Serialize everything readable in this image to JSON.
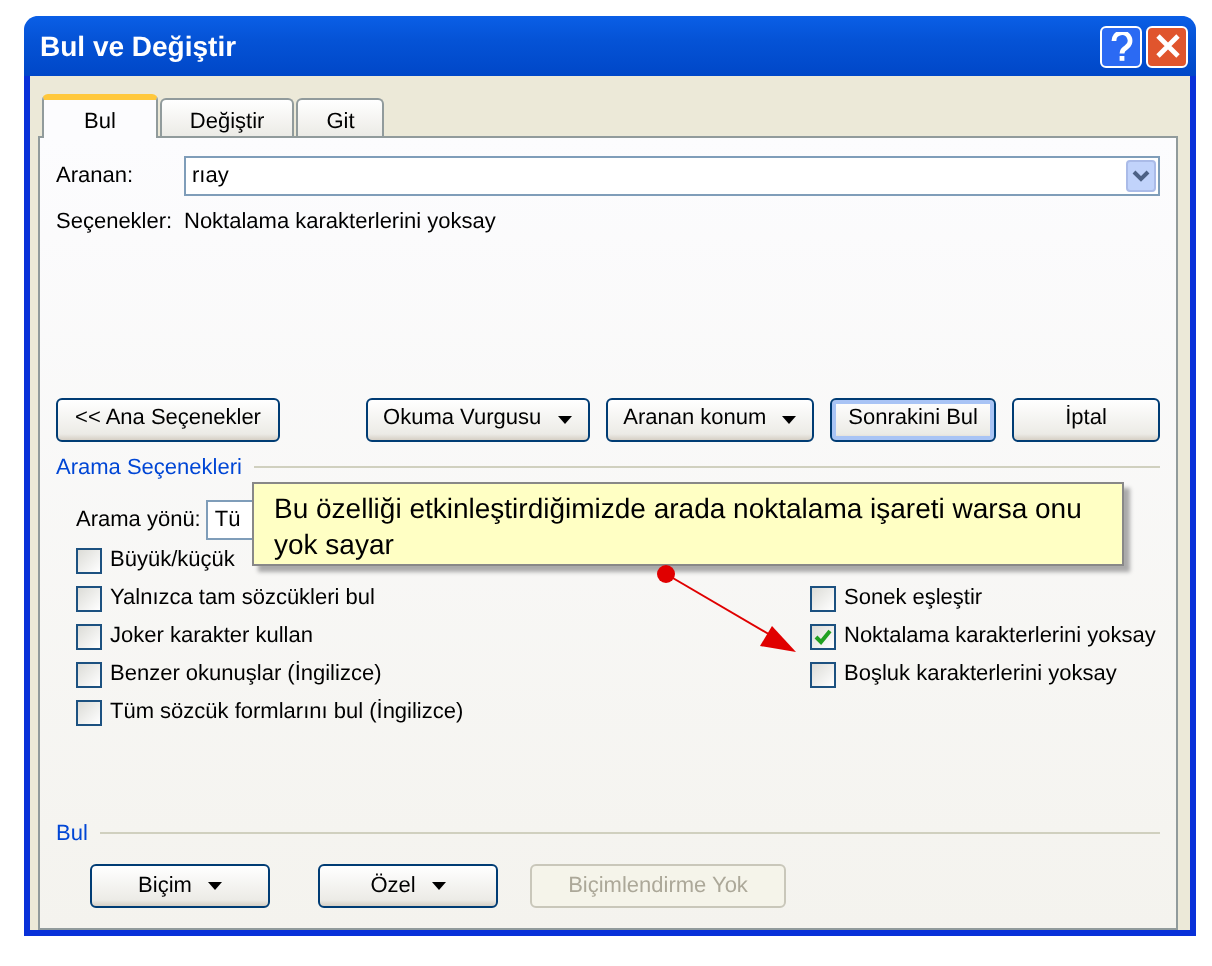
{
  "window": {
    "title": "Bul ve Değiştir"
  },
  "tabs": [
    {
      "label": "Bul",
      "selected": true
    },
    {
      "label": "Değiştir",
      "selected": false
    },
    {
      "label": "Git",
      "selected": false
    }
  ],
  "find": {
    "label": "Aranan:",
    "value": "rıay"
  },
  "options_line": {
    "label": "Seçenekler:",
    "value": "Noktalama karakterlerini yoksay"
  },
  "buttons": [
    {
      "label": "<< Ana Seçenekler",
      "kind": "plain"
    },
    {
      "label": "Okuma Vurgusu",
      "kind": "dropdown"
    },
    {
      "label": "Aranan konum",
      "kind": "dropdown"
    },
    {
      "label": "Sonrakini Bul",
      "kind": "default"
    },
    {
      "label": "İptal",
      "kind": "plain"
    }
  ],
  "search_options": {
    "title": "Arama Seçenekleri",
    "direction": {
      "label": "Arama yönü:",
      "value": "Tü"
    },
    "left": [
      {
        "label": "Büyük/küçük",
        "checked": false
      },
      {
        "label": "Yalnızca tam sözcükleri bul",
        "checked": false
      },
      {
        "label": "Joker karakter kullan",
        "checked": false
      },
      {
        "label": "Benzer okunuşlar (İngilizce)",
        "checked": false
      },
      {
        "label": "Tüm sözcük formlarını bul (İngilizce)",
        "checked": false
      }
    ],
    "right": [
      {
        "label": "Sonek eşleştir",
        "checked": false
      },
      {
        "label": "Noktalama karakterlerini yoksay",
        "checked": true
      },
      {
        "label": "Boşluk karakterlerini yoksay",
        "checked": false
      }
    ]
  },
  "tooltip": {
    "text": "Bu özelliği etkinleştirdiğimizde arada noktalama işareti warsa onu yok sayar"
  },
  "format": {
    "title": "Bul",
    "buttons": [
      {
        "label": "Biçim",
        "kind": "dropdown",
        "disabled": false
      },
      {
        "label": "Özel",
        "kind": "dropdown",
        "disabled": false
      },
      {
        "label": "Biçimlendirme Yok",
        "kind": "plain",
        "disabled": true
      }
    ]
  }
}
